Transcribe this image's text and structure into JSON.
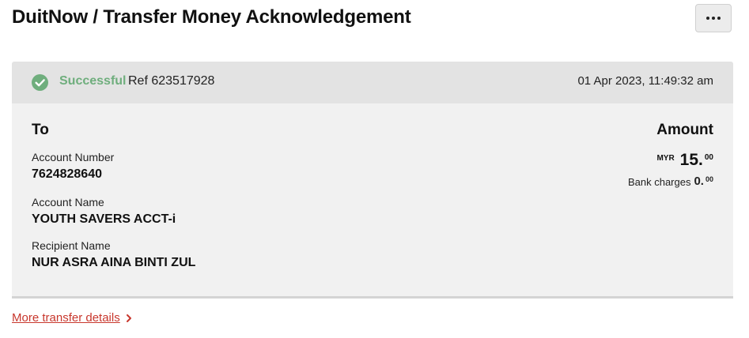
{
  "page": {
    "title": "DuitNow / Transfer Money Acknowledgement"
  },
  "header_actions": {
    "more_icon": "more-horizontal-icon"
  },
  "status_bar": {
    "status": "Successful",
    "reference": "Ref 623517928",
    "timestamp": "01 Apr 2023, 11:49:32 am",
    "status_color": "#6fae7d",
    "icon": "check-circle-icon"
  },
  "recipient": {
    "heading": "To",
    "account_number_label": "Account Number",
    "account_number": "7624828640",
    "account_name_label": "Account Name",
    "account_name": "YOUTH SAVERS ACCT-i",
    "recipient_name_label": "Recipient Name",
    "recipient_name": "NUR ASRA AINA BINTI ZUL"
  },
  "amount": {
    "heading": "Amount",
    "currency": "MYR",
    "value_main": "15.",
    "value_cents": "00",
    "bank_charges_label": "Bank charges",
    "bank_charges_main": "0.",
    "bank_charges_cents": "00"
  },
  "footer": {
    "details_link": "More transfer details",
    "link_color": "#c8372d",
    "chevron_icon": "chevron-right-icon"
  }
}
